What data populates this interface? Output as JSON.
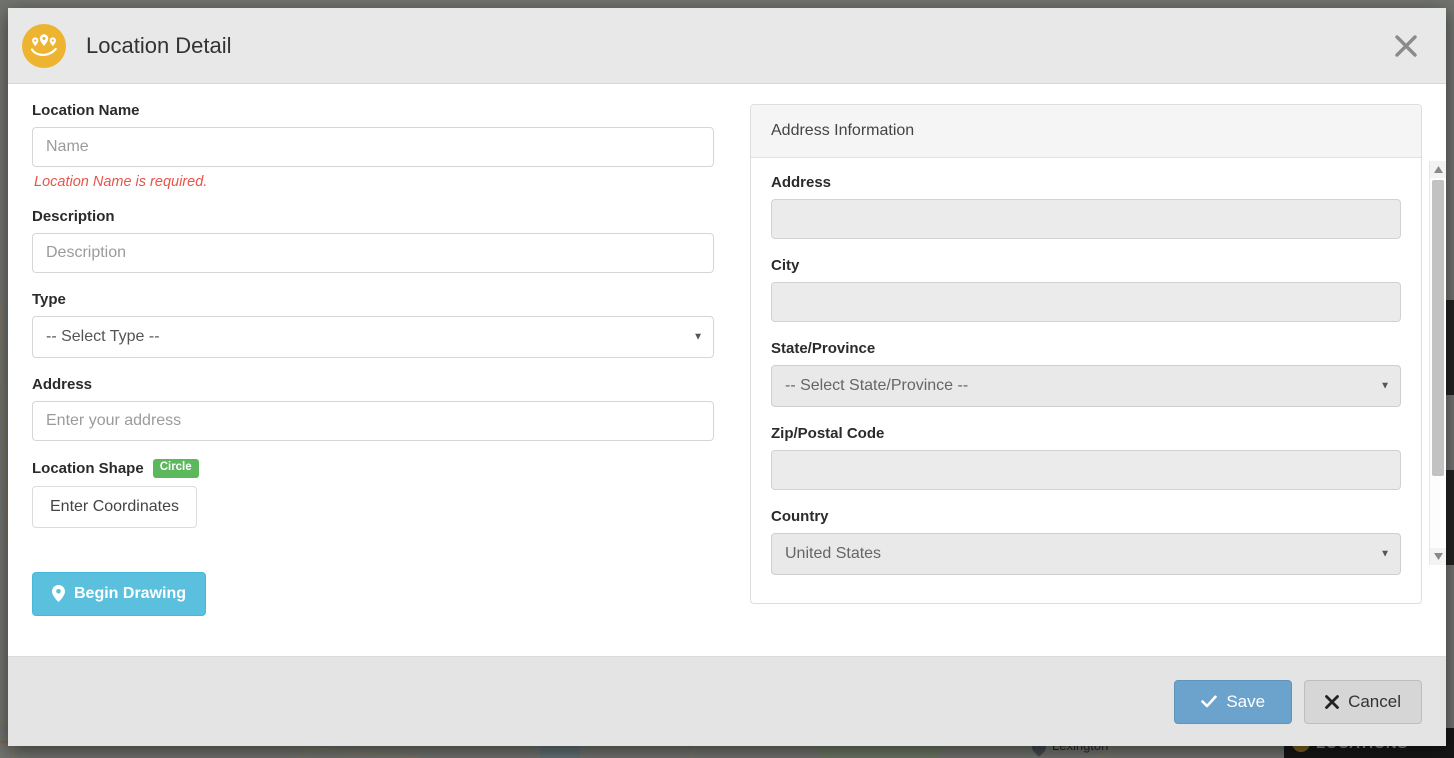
{
  "modal": {
    "title": "Location Detail",
    "logo_icon": "locations-pins-logo-icon",
    "close_icon": "close-icon"
  },
  "left_form": {
    "location_name": {
      "label": "Location Name",
      "placeholder": "Name",
      "value": "",
      "error": "Location Name is required."
    },
    "description": {
      "label": "Description",
      "placeholder": "Description",
      "value": ""
    },
    "type": {
      "label": "Type",
      "selected": "-- Select Type --",
      "caret_icon": "chevron-down-icon"
    },
    "address": {
      "label": "Address",
      "placeholder": "Enter your address",
      "value": ""
    },
    "location_shape": {
      "label": "Location Shape",
      "badge": "Circle",
      "badge_color": "#5cb85c",
      "enter_coordinates_label": "Enter Coordinates"
    },
    "begin_drawing": {
      "label": "Begin Drawing",
      "icon": "map-marker-icon",
      "color": "#5bc0de"
    }
  },
  "address_panel": {
    "header": "Address Information",
    "address": {
      "label": "Address",
      "value": ""
    },
    "city": {
      "label": "City",
      "value": ""
    },
    "state": {
      "label": "State/Province",
      "selected": "-- Select State/Province --",
      "caret_icon": "chevron-down-icon"
    },
    "zip": {
      "label": "Zip/Postal Code",
      "value": ""
    },
    "country": {
      "label": "Country",
      "selected": "United States",
      "caret_icon": "chevron-down-icon"
    }
  },
  "footer": {
    "save_label": "Save",
    "save_icon": "check-icon",
    "save_color": "#6ba3cd",
    "cancel_label": "Cancel",
    "cancel_icon": "times-icon"
  },
  "scrollbar": {
    "up_icon": "triangle-up-icon",
    "down_icon": "triangle-down-icon"
  },
  "background": {
    "map_label_lexington": "Lexington",
    "locations_panel_label": "LOCATIONS"
  }
}
